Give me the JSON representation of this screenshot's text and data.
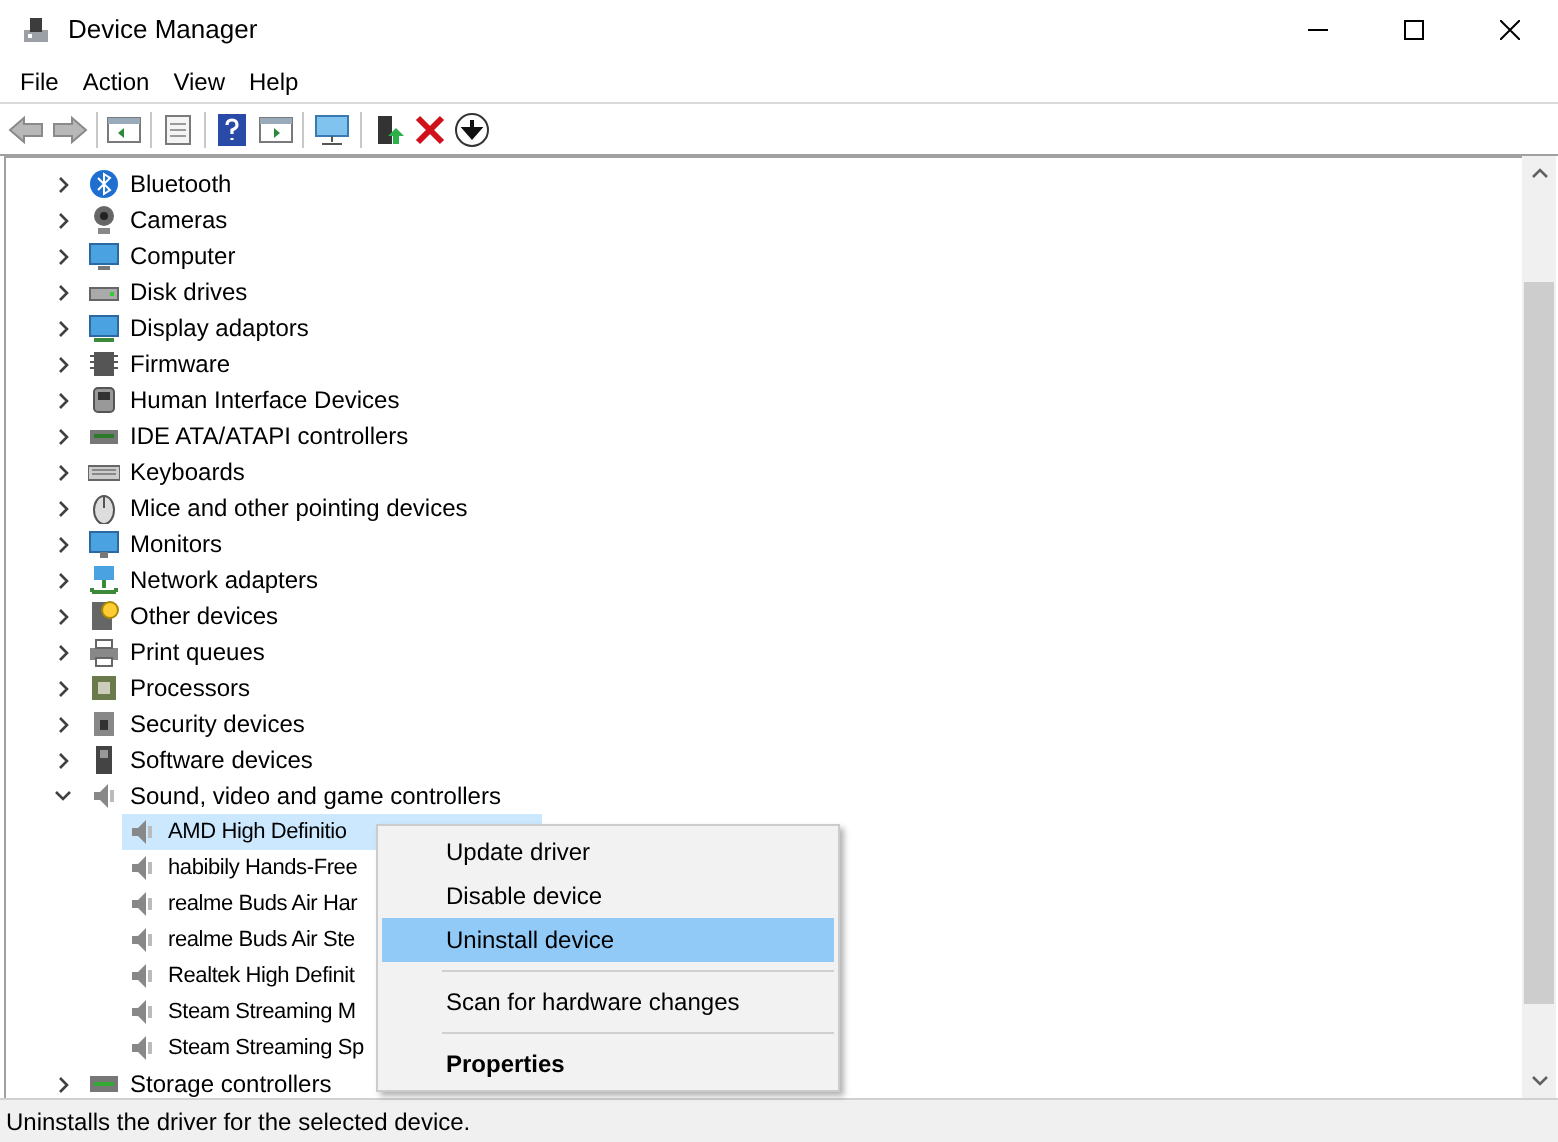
{
  "window": {
    "title": "Device Manager"
  },
  "menu_bar": [
    "File",
    "Action",
    "View",
    "Help"
  ],
  "tree": [
    {
      "label": "Bluetooth",
      "expanded": false
    },
    {
      "label": "Cameras",
      "expanded": false
    },
    {
      "label": "Computer",
      "expanded": false
    },
    {
      "label": "Disk drives",
      "expanded": false
    },
    {
      "label": "Display adaptors",
      "expanded": false
    },
    {
      "label": "Firmware",
      "expanded": false
    },
    {
      "label": "Human Interface Devices",
      "expanded": false
    },
    {
      "label": "IDE ATA/ATAPI controllers",
      "expanded": false
    },
    {
      "label": "Keyboards",
      "expanded": false
    },
    {
      "label": "Mice and other pointing devices",
      "expanded": false
    },
    {
      "label": "Monitors",
      "expanded": false
    },
    {
      "label": "Network adapters",
      "expanded": false
    },
    {
      "label": "Other devices",
      "expanded": false
    },
    {
      "label": "Print queues",
      "expanded": false
    },
    {
      "label": "Processors",
      "expanded": false
    },
    {
      "label": "Security devices",
      "expanded": false
    },
    {
      "label": "Software devices",
      "expanded": false
    },
    {
      "label": "Sound, video and game controllers",
      "expanded": true,
      "children": [
        {
          "label": "AMD High Definitio",
          "selected": true
        },
        {
          "label": "habibily Hands-Free",
          "selected": false
        },
        {
          "label": "realme Buds Air Har",
          "selected": false
        },
        {
          "label": "realme Buds Air Ste",
          "selected": false
        },
        {
          "label": "Realtek High Definit",
          "selected": false
        },
        {
          "label": "Steam Streaming M",
          "selected": false
        },
        {
          "label": "Steam Streaming Sp",
          "selected": false
        }
      ]
    },
    {
      "label": "Storage controllers",
      "expanded": false
    }
  ],
  "context_menu": [
    {
      "kind": "item",
      "label": "Update driver",
      "selected": false
    },
    {
      "kind": "item",
      "label": "Disable device",
      "selected": false
    },
    {
      "kind": "item",
      "label": "Uninstall device",
      "selected": true
    },
    {
      "kind": "separator"
    },
    {
      "kind": "item",
      "label": "Scan for hardware changes",
      "selected": false
    },
    {
      "kind": "separator"
    },
    {
      "kind": "default",
      "label": "Properties",
      "selected": false
    }
  ],
  "status_bar": "Uninstalls the driver for the selected device."
}
